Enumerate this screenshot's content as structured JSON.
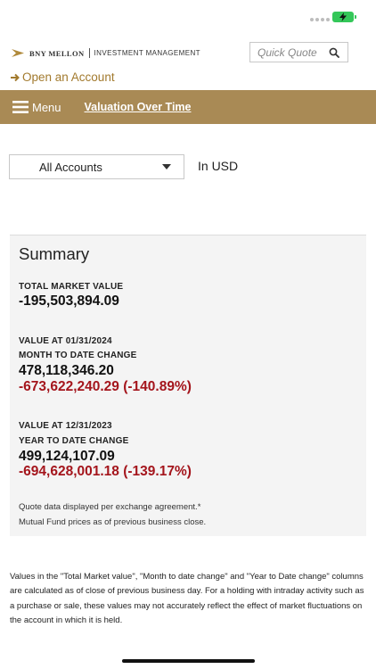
{
  "header": {
    "brand_bold": "BNY MELLON",
    "brand_rest": "INVESTMENT MANAGEMENT",
    "quick_quote_placeholder": "Quick Quote",
    "open_account_label": "Open an Account"
  },
  "nav": {
    "menu_label": "Menu",
    "link_label": "Valuation Over Time",
    "bar_color": "#a98a55"
  },
  "filters": {
    "account_selected": "All Accounts",
    "currency_label": "In USD"
  },
  "summary": {
    "title": "Summary",
    "total_market_value_label": "TOTAL MARKET VALUE",
    "total_market_value": "-195,503,894.09",
    "mtd_date_label": "VALUE AT 01/31/2024",
    "mtd_change_label": "MONTH TO DATE CHANGE",
    "mtd_value": "478,118,346.20",
    "mtd_change": "-673,622,240.29 (-140.89%)",
    "ytd_date_label": "VALUE AT 12/31/2023",
    "ytd_change_label": "YEAR TO DATE CHANGE",
    "ytd_value": "499,124,107.09",
    "ytd_change": "-694,628,001.18 (-139.17%)",
    "note_quote": "Quote data displayed per exchange agreement.*",
    "note_mutual_fund": "Mutual Fund prices as of previous business close.",
    "negative_color": "#a4151c"
  },
  "disclaimer": "Values in the \"Total Market value\", \"Month to date change\" and \"Year to Date change\" columns are calculated as of close of previous business day. For a holding with intraday activity such as a purchase or sale, these values may not accurately reflect the effect of market fluctuations on the account in which it is held."
}
